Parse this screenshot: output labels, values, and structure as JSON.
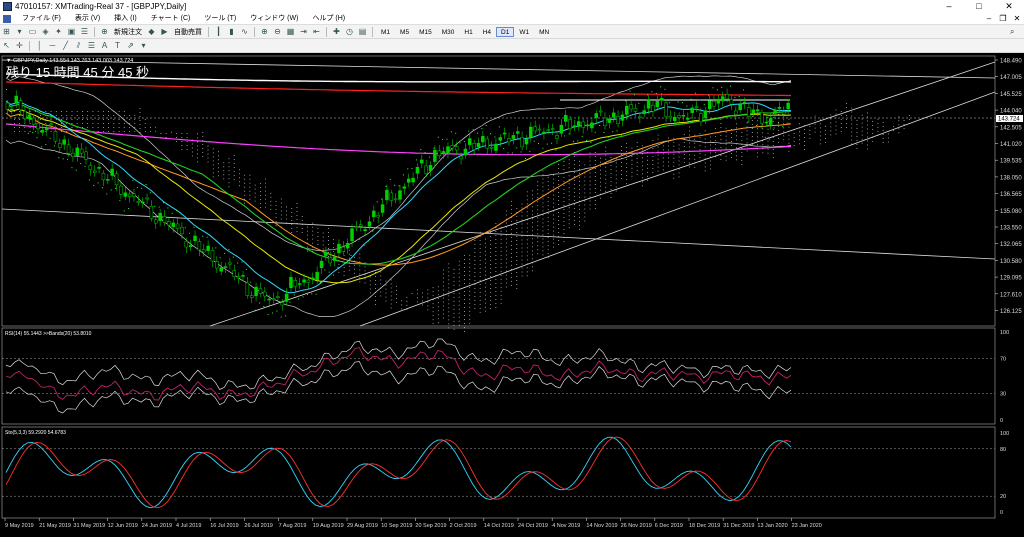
{
  "window": {
    "title": "47010157: XMTrading-Real 37 - [GBPJPY,Daily]",
    "min_label": "–",
    "max_label": "□",
    "close_label": "✕"
  },
  "menu": {
    "items": [
      "ファイル (F)",
      "表示 (V)",
      "挿入 (I)",
      "チャート (C)",
      "ツール (T)",
      "ウィンドウ (W)",
      "ヘルプ (H)"
    ],
    "mini_controls": [
      "–",
      "❐",
      "✕"
    ]
  },
  "toolbar": {
    "new_order_label": "新規注文",
    "auto_trade_label": "自動売買",
    "timeframes": [
      "M1",
      "M5",
      "M15",
      "M30",
      "H1",
      "H4",
      "D1",
      "W1",
      "MN"
    ],
    "active_timeframe": "D1"
  },
  "main_chart": {
    "header": "▼ GBPJPY,Daily  143.554 143.763 143.003 143.724",
    "countdown": "残り 15 時間 45 分 45 秒",
    "current_price": "143.724",
    "price_ticks": [
      "148.490",
      "147.005",
      "145.525",
      "144.040",
      "142.505",
      "141.020",
      "139.535",
      "138.050",
      "136.565",
      "135.080",
      "133.550",
      "132.065",
      "130.580",
      "129.095",
      "127.610",
      "126.125"
    ],
    "colors": {
      "bull": "#00d000",
      "bear": "#000000",
      "ma_red": "#ff2020",
      "ma_magenta": "#ff40ff",
      "ma_orange": "#ff9a20",
      "ma_yellow": "#e8e800",
      "ma_green": "#20d020",
      "ma_cyan": "#30d8ff",
      "bands": "#d0d0d0"
    }
  },
  "rsi": {
    "header": "RSI(14) 55.1443 >>Bands(20) 53.8010",
    "ticks": [
      "100",
      "70",
      "30",
      "0"
    ]
  },
  "stoch": {
    "header": "Sto(5,3,3) 59.2920 54.6783",
    "ticks": [
      "100",
      "80",
      "20",
      "0"
    ]
  },
  "x_axis": {
    "labels": [
      "9 May 2019",
      "21 May 2019",
      "31 May 2019",
      "12 Jun 2019",
      "24 Jun 2019",
      "4 Jul 2019",
      "16 Jul 2019",
      "26 Jul 2019",
      "7 Aug 2019",
      "19 Aug 2019",
      "29 Aug 2019",
      "10 Sep 2019",
      "20 Sep 2019",
      "2 Oct 2019",
      "14 Oct 2019",
      "24 Oct 2019",
      "4 Nov 2019",
      "14 Nov 2019",
      "26 Nov 2019",
      "6 Dec 2019",
      "18 Dec 2019",
      "31 Dec 2019",
      "13 Jan 2020",
      "23 Jan 2020"
    ]
  }
}
